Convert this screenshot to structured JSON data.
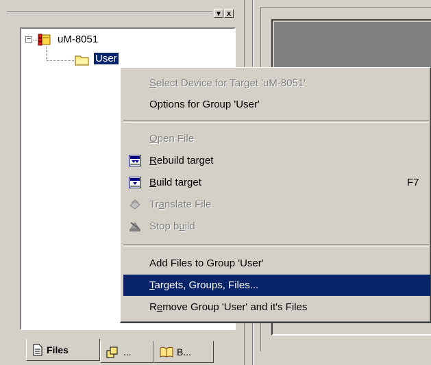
{
  "colors": {
    "face": "#d4d0c8",
    "highlight": "#0a246a",
    "shadow": "#808080"
  },
  "title_bar": {
    "min_icon": "chevron-down-icon",
    "close_label": "x"
  },
  "tree": {
    "root": {
      "label": "uM-8051",
      "icon": "target-icon",
      "expander": "−"
    },
    "child": {
      "label": "User",
      "icon": "folder-icon"
    }
  },
  "tabs": [
    {
      "label": "Files",
      "icon": "files-icon"
    },
    {
      "label": "...",
      "icon": "regs-icon"
    },
    {
      "label": "B...",
      "icon": "books-icon"
    }
  ],
  "menu": {
    "select_device": {
      "pre": "",
      "ul": "S",
      "post": "elect Device for Target 'uM-8051'"
    },
    "options_group": "Options for Group 'User'",
    "open_file": {
      "pre": "",
      "ul": "O",
      "post": "pen File"
    },
    "rebuild": {
      "pre": "",
      "ul": "R",
      "post": "ebuild target"
    },
    "build": {
      "pre": "",
      "ul": "B",
      "post": "uild target",
      "shortcut": "F7"
    },
    "translate": {
      "pre": "Tr",
      "ul": "a",
      "post": "nslate File"
    },
    "stop_build": {
      "pre": "Stop b",
      "ul": "u",
      "post": "ild"
    },
    "add_files": "Add Files to Group 'User'",
    "targets": {
      "pre": "",
      "ul": "T",
      "post": "argets, Groups, Files..."
    },
    "remove_group": {
      "pre": "R",
      "ul": "e",
      "post": "move Group 'User' and it's Files"
    }
  }
}
